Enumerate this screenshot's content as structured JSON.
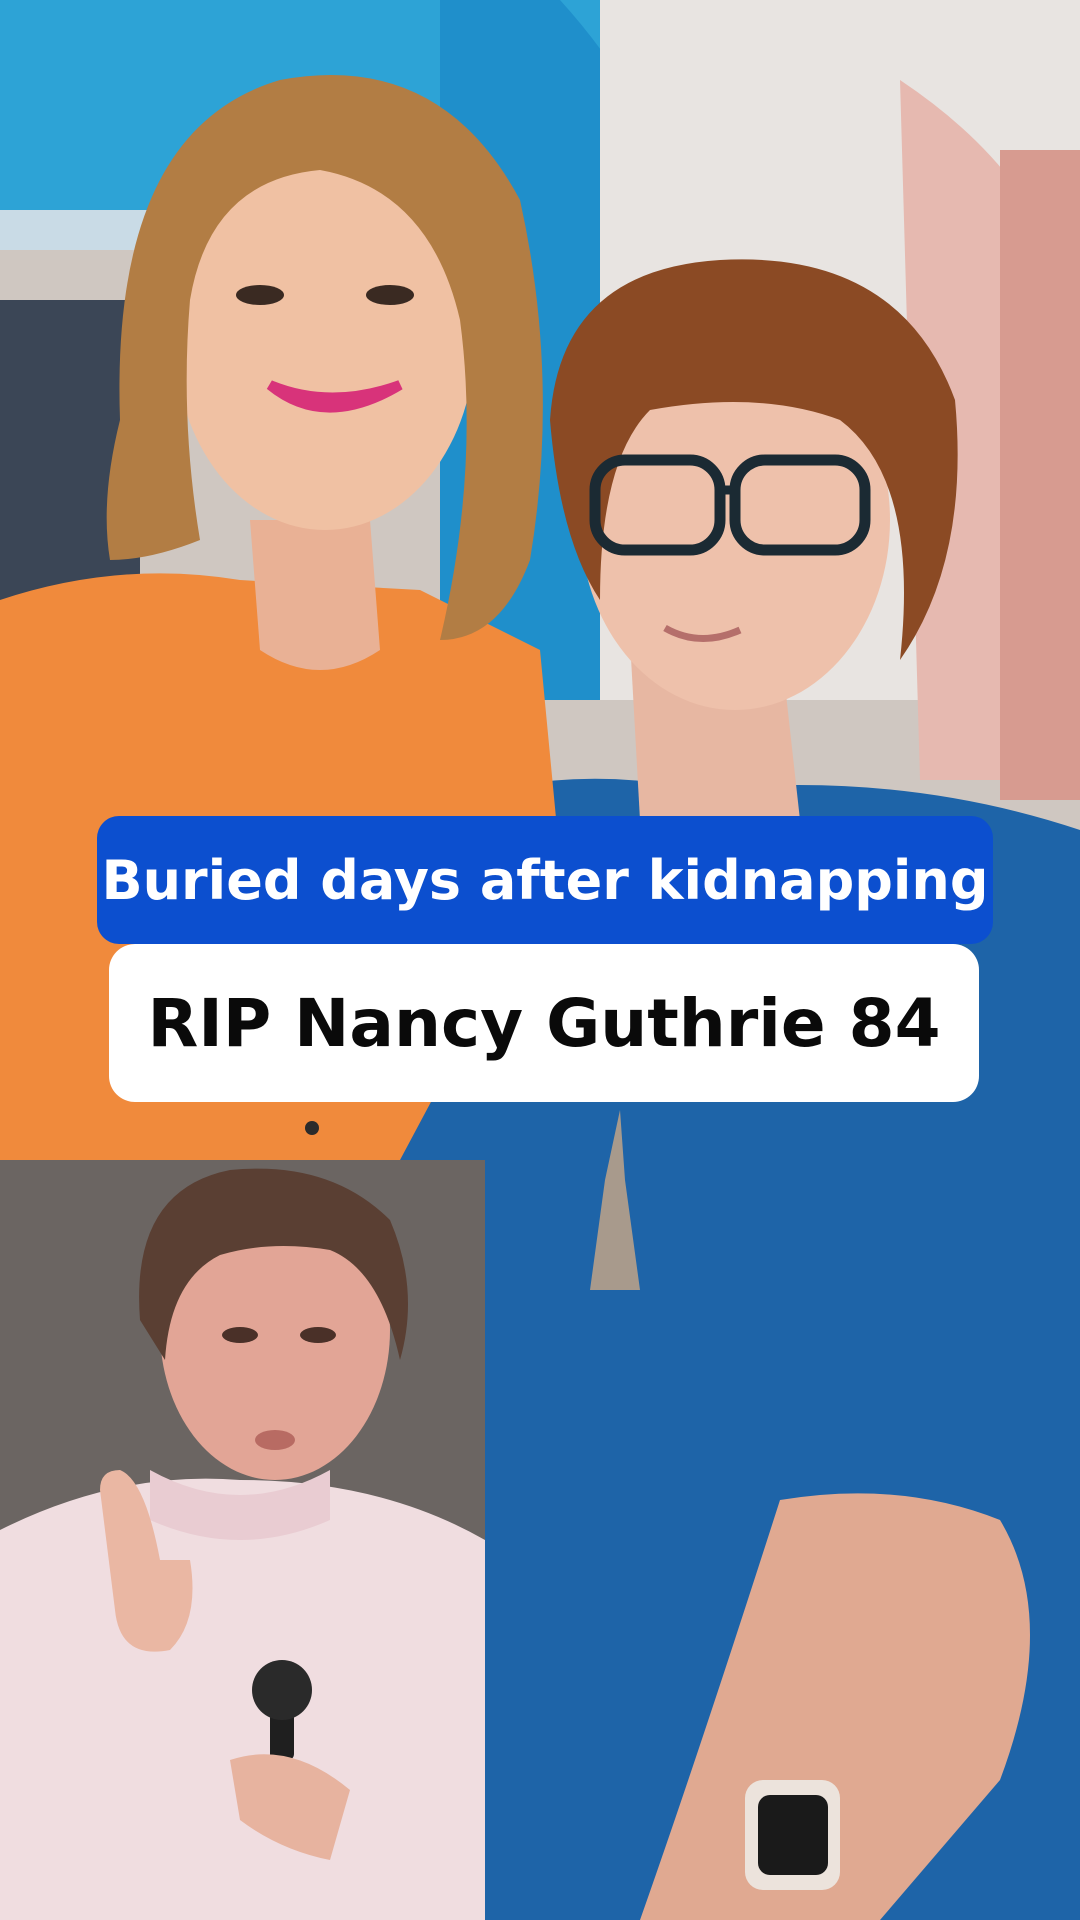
{
  "captions": {
    "top": "Buried days after kidnapping",
    "bottom": "RIP Nancy Guthrie 84"
  },
  "colors": {
    "caption_top_bg": "#0c4fcf",
    "caption_bottom_bg": "#ffffff",
    "caption_top_text": "#ffffff",
    "caption_bottom_text": "#0a0a0a"
  }
}
